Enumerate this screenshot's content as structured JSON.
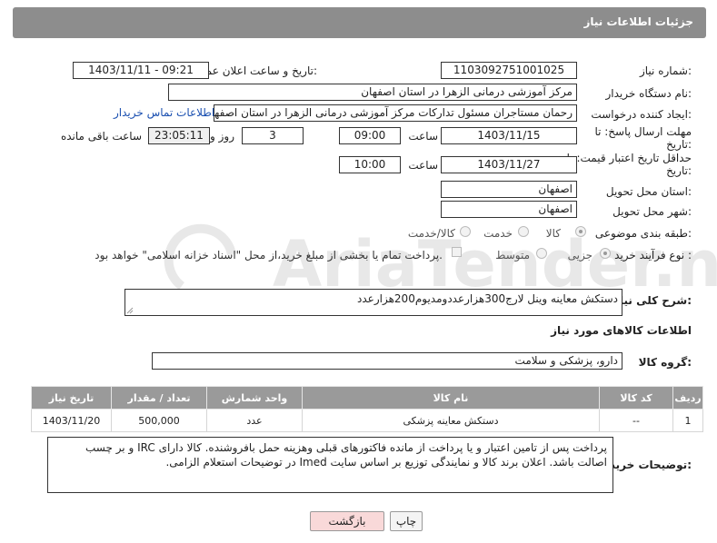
{
  "header": {
    "title": "جزئیات اطلاعات نیاز"
  },
  "form": {
    "need_number_label": "شماره نیاز:",
    "need_number": "1103092751001025",
    "announce_label": "تاریخ و ساعت اعلان عمومی:",
    "announce_value": "1403/11/11 - 09:21",
    "buyer_org_label": "نام دستگاه خریدار:",
    "buyer_org": "مرکز آموزشی درمانی الزهرا در استان اصفهان",
    "creator_label": "ایجاد کننده درخواست:",
    "creator": "رحمان مستاجران مسئول تدارکات مرکز آموزشی درمانی الزهرا در استان اصفهان",
    "contact_link": "اطلاعات تماس خریدار",
    "deadline_label_1": "مهلت ارسال پاسخ: تا",
    "deadline_label_2": "تاریخ:",
    "deadline_date": "1403/11/15",
    "time_label": "ساعت",
    "deadline_time": "09:00",
    "days_value": "3",
    "days_label": "روز و",
    "remaining_value": "23:05:11",
    "remaining_label": "ساعت باقی مانده",
    "min_price_label_1": "حداقل تاریخ اعتبار قیمت: تا",
    "min_price_label_2": "تاریخ:",
    "min_price_date": "1403/11/27",
    "min_price_time": "10:00",
    "province_label": "استان محل تحویل:",
    "province": "اصفهان",
    "city_label": "شهر محل تحویل:",
    "city": "اصفهان",
    "category_label": "طبقه بندی موضوعی:",
    "category_options": [
      "کالا",
      "خدمت",
      "کالا/خدمت"
    ],
    "process_label": "نوع فرآیند خرید :",
    "process_options": [
      "جزیی",
      "متوسط"
    ],
    "payment_note": "پرداخت تمام یا بخشی از مبلغ خرید،از محل \"اسناد خزانه اسلامی\" خواهد بود."
  },
  "description": {
    "label": "شرح کلی نیاز:",
    "value": "دستکش معاینه وینل لارج300هزارعددومدیوم200هزارعدد"
  },
  "goods": {
    "section_title": "اطلاعات کالاهای مورد نیاز",
    "group_label": "گروه کالا:",
    "group_value": "دارو، پزشکی و سلامت",
    "columns": [
      "ردیف",
      "کد کالا",
      "نام کالا",
      "واحد شمارش",
      "تعداد / مقدار",
      "تاریخ نیاز"
    ],
    "rows": [
      {
        "row": "1",
        "code": "--",
        "name": "دستکش معاینه پزشکی",
        "unit": "عدد",
        "qty": "500,000",
        "date": "1403/11/20"
      }
    ]
  },
  "buyer_notes": {
    "label": "توضیحات خریدار:",
    "value": "پرداخت پس از تامین اعتبار و یا پرداخت از مانده فاکتورهای قبلی وهزینه حمل بافروشنده. کالا دارای IRC و بر چسب اصالت باشد. اعلان برند کالا و نمایندگی توزیع بر اساس سایت Imed در توضیحات استعلام الزامی."
  },
  "buttons": {
    "print": "چاپ",
    "back": "بازگشت"
  },
  "watermark_text": "AriaTender.neT",
  "colors": {
    "title_bar": "#8d8d8d",
    "table_header": "#9a9a9a",
    "back_button": "#f9d9d9",
    "link": "#1a4fb0"
  }
}
